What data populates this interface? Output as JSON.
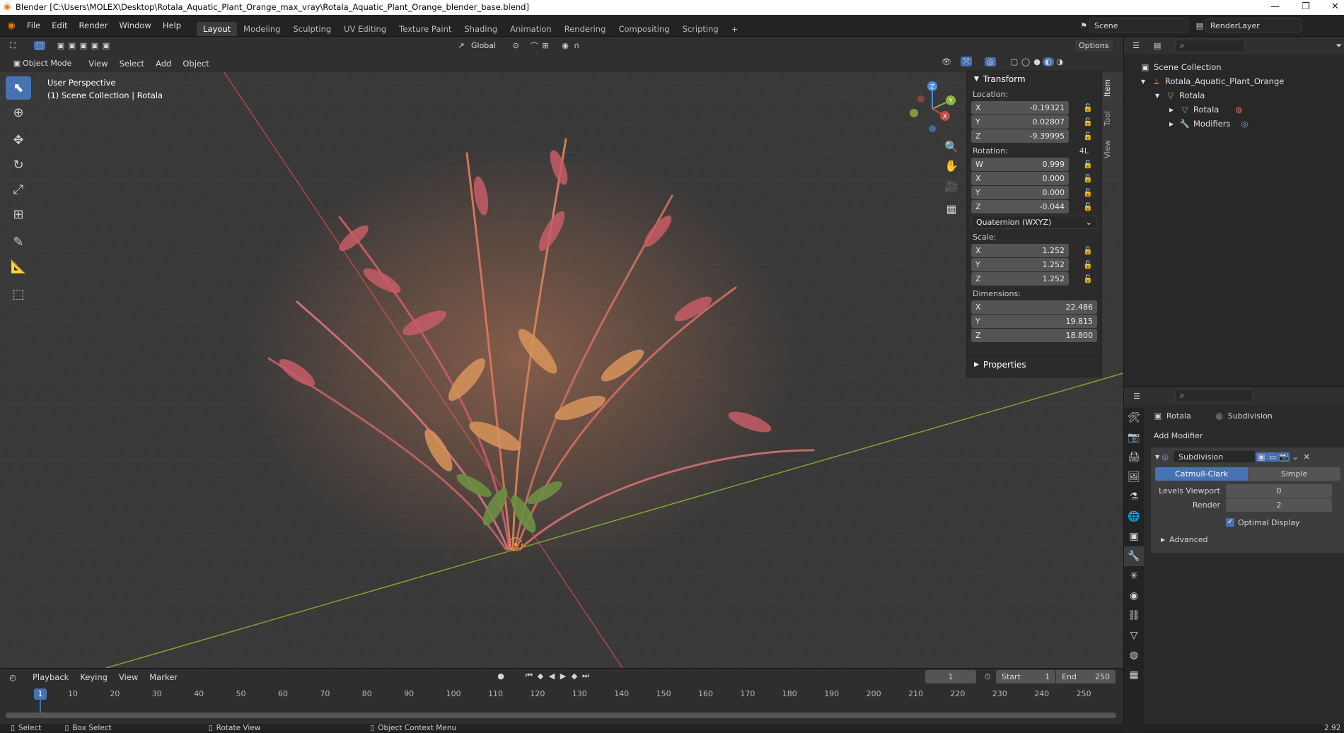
{
  "window": {
    "title": "Blender [C:\\Users\\MOLEX\\Desktop\\Rotala_Aquatic_Plant_Orange_max_vray\\Rotala_Aquatic_Plant_Orange_blender_base.blend]",
    "minimize": "—",
    "restore": "❐"
  },
  "menus": [
    "File",
    "Edit",
    "Render",
    "Window",
    "Help"
  ],
  "workspaces": [
    "Layout",
    "Modeling",
    "Sculpting",
    "UV Editing",
    "Texture Paint",
    "Shading",
    "Animation",
    "Rendering",
    "Compositing",
    "Scripting"
  ],
  "add_workspace": "+",
  "scene": {
    "name": "Scene",
    "render_layer": "RenderLayer"
  },
  "viewport_header": {
    "transform_orientation": "Global",
    "options": "Options",
    "mode": "Object Mode",
    "menus": [
      "View",
      "Select",
      "Add",
      "Object"
    ]
  },
  "viewport_info": {
    "line1": "User Perspective",
    "line2": "(1) Scene Collection | Rotala"
  },
  "gizmo": {
    "x": "X",
    "y": "Y",
    "z": "Z"
  },
  "npanel": {
    "tabs": [
      "Item",
      "Tool",
      "View"
    ],
    "transform_title": "Transform",
    "location_label": "Location:",
    "location": [
      {
        "axis": "X",
        "value": "-0.19321"
      },
      {
        "axis": "Y",
        "value": "0.02807"
      },
      {
        "axis": "Z",
        "value": "-9.39995"
      }
    ],
    "rotation_label": "Rotation:",
    "rotation_flag": "4L",
    "rotation": [
      {
        "axis": "W",
        "value": "0.999"
      },
      {
        "axis": "X",
        "value": "0.000"
      },
      {
        "axis": "Y",
        "value": "0.000"
      },
      {
        "axis": "Z",
        "value": "-0.044"
      }
    ],
    "rotation_mode": "Quaternion (WXYZ)",
    "scale_label": "Scale:",
    "scale": [
      {
        "axis": "X",
        "value": "1.252"
      },
      {
        "axis": "Y",
        "value": "1.252"
      },
      {
        "axis": "Z",
        "value": "1.252"
      }
    ],
    "dimensions_label": "Dimensions:",
    "dimensions": [
      {
        "axis": "X",
        "value": "22.486"
      },
      {
        "axis": "Y",
        "value": "19.815"
      },
      {
        "axis": "Z",
        "value": "18.800"
      }
    ],
    "properties_title": "Properties"
  },
  "outliner": {
    "root": "Scene Collection",
    "rows": [
      "Rotala_Aquatic_Plant_Orange",
      "Rotala",
      "Rotala",
      "Modifiers"
    ]
  },
  "properties": {
    "object_name": "Rotala",
    "modifier_context": "Subdivision",
    "add_modifier": "Add Modifier",
    "modifier_name": "Subdivision",
    "type_catmull": "Catmull-Clark",
    "type_simple": "Simple",
    "levels_viewport_label": "Levels Viewport",
    "levels_viewport": "0",
    "render_label": "Render",
    "render": "2",
    "optimal_display": "Optimal Display",
    "advanced": "Advanced"
  },
  "timeline": {
    "menus": [
      "Playback",
      "Keying",
      "View",
      "Marker"
    ],
    "current_frame": "1",
    "start_label": "Start",
    "start": "1",
    "end_label": "End",
    "end": "250",
    "ticks": [
      "10",
      "20",
      "30",
      "40",
      "50",
      "60",
      "70",
      "80",
      "90",
      "100",
      "110",
      "120",
      "130",
      "140",
      "150",
      "160",
      "170",
      "180",
      "190",
      "200",
      "210",
      "220",
      "230",
      "240",
      "250"
    ]
  },
  "statusbar": {
    "select": "Select",
    "box_select": "Box Select",
    "rotate_view": "Rotate View",
    "context_menu": "Object Context Menu",
    "version": "2.92"
  },
  "colors": {
    "accent": "#4772b3",
    "x_axis": "#c34a4a",
    "y_axis": "#8bb33d",
    "z_axis": "#4d8ce0"
  }
}
